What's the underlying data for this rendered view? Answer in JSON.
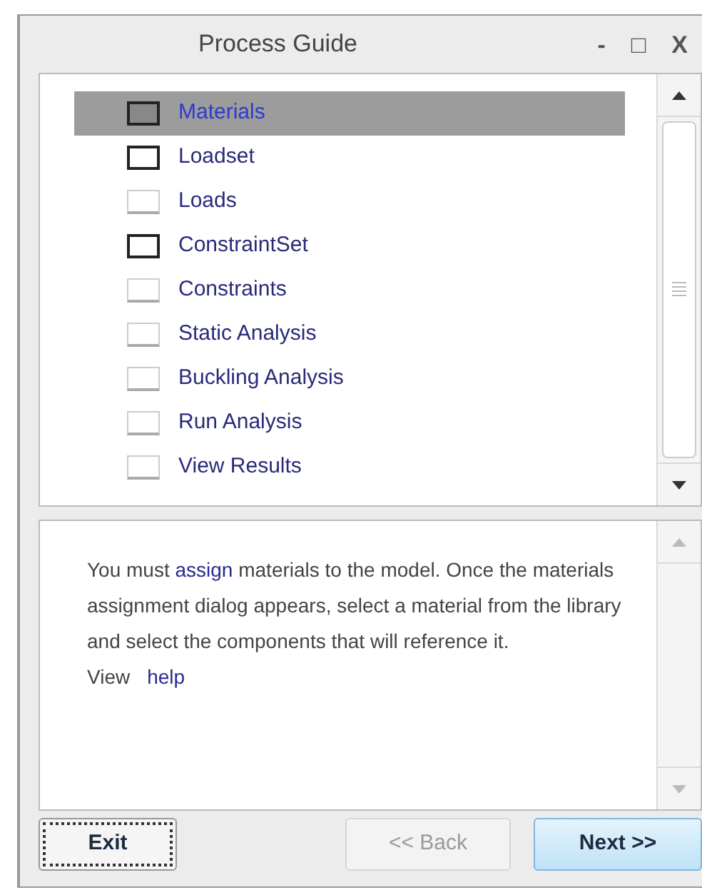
{
  "window": {
    "title": "Process Guide",
    "controls": [
      "-",
      "□",
      "X"
    ]
  },
  "steps": [
    {
      "label": "Materials",
      "kind": "set",
      "selected": true
    },
    {
      "label": "Loadset",
      "kind": "set",
      "selected": false
    },
    {
      "label": "Loads",
      "kind": "step",
      "selected": false
    },
    {
      "label": "ConstraintSet",
      "kind": "set",
      "selected": false
    },
    {
      "label": "Constraints",
      "kind": "step",
      "selected": false
    },
    {
      "label": "Static Analysis",
      "kind": "step",
      "selected": false
    },
    {
      "label": "Buckling Analysis",
      "kind": "step",
      "selected": false
    },
    {
      "label": "Run Analysis",
      "kind": "step",
      "selected": false
    },
    {
      "label": "View Results",
      "kind": "step",
      "selected": false
    }
  ],
  "description": {
    "before": "You must",
    "link": "assign",
    "after": "materials to the model. Once the materials assignment dialog appears, select a material from the library and select the components that will reference it.",
    "view_label": "View",
    "help_link": "help"
  },
  "buttons": [
    {
      "label": "Exit",
      "kind": "focused",
      "disabled": false
    },
    {
      "label": "<< Back",
      "kind": "normal",
      "disabled": true
    },
    {
      "label": "Next >>",
      "kind": "default",
      "disabled": false
    }
  ]
}
